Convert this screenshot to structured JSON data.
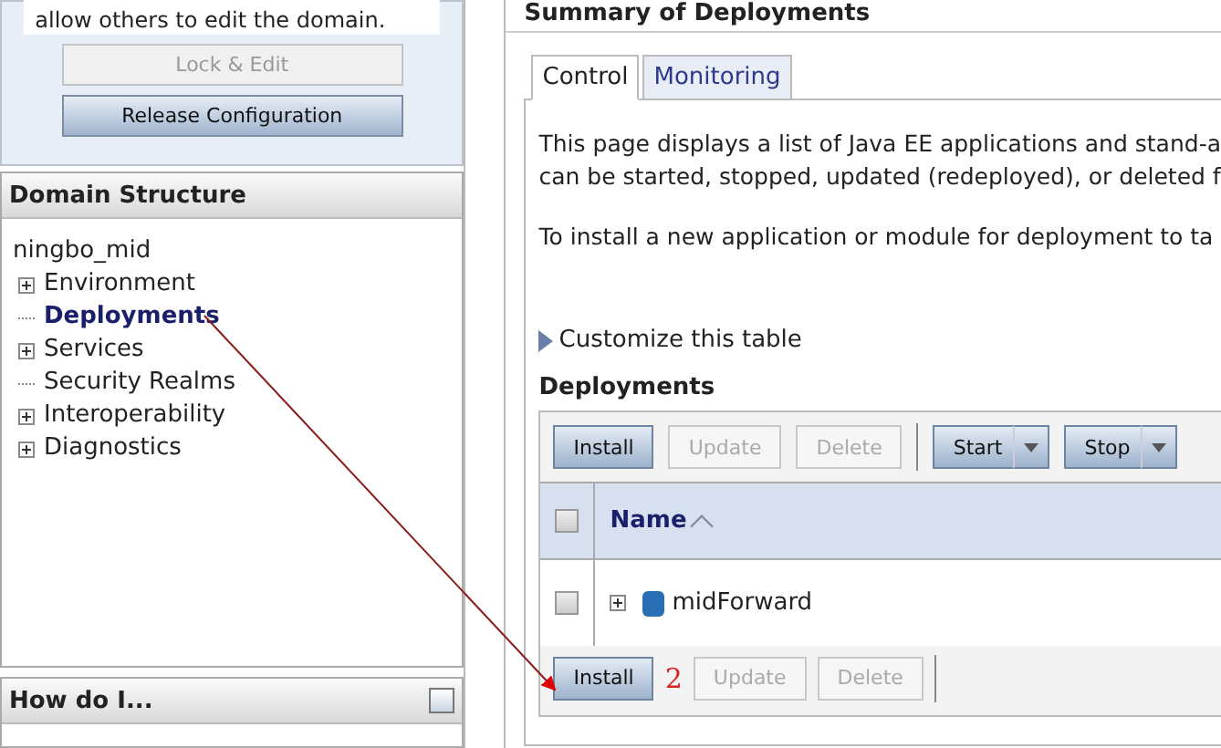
{
  "change_center": {
    "message": "allow others to edit the domain.",
    "buttons": [
      {
        "label": "Lock & Edit",
        "disabled": true
      },
      {
        "label": "Release Configuration",
        "disabled": false
      }
    ]
  },
  "domain_structure": {
    "title": "Domain Structure",
    "root": "ningbo_mid",
    "items": [
      {
        "label": "Environment",
        "expandable": true,
        "selected": false
      },
      {
        "label": "Deployments",
        "expandable": false,
        "selected": true
      },
      {
        "label": "Services",
        "expandable": true,
        "selected": false
      },
      {
        "label": "Security Realms",
        "expandable": false,
        "selected": false
      },
      {
        "label": "Interoperability",
        "expandable": true,
        "selected": false
      },
      {
        "label": "Diagnostics",
        "expandable": true,
        "selected": false
      }
    ]
  },
  "how_do_i": {
    "title": "How do I..."
  },
  "page_title": "Summary of Deployments",
  "tabs": [
    {
      "label": "Control",
      "selected": true
    },
    {
      "label": "Monitoring",
      "selected": false
    }
  ],
  "paragraphs": [
    [
      "This page displays a list of Java EE applications and stand-a",
      "can be started, stopped, updated (redeployed), or deleted f"
    ],
    [
      "To install a new application or module for deployment to ta"
    ]
  ],
  "customize_link": "Customize this table",
  "table": {
    "title": "Deployments",
    "toolbar": [
      {
        "kind": "button",
        "label": "Install",
        "disabled": false
      },
      {
        "kind": "button",
        "label": "Update",
        "disabled": true
      },
      {
        "kind": "button",
        "label": "Delete",
        "disabled": true
      },
      {
        "kind": "separator"
      },
      {
        "kind": "split",
        "label": "Start",
        "disabled": false
      },
      {
        "kind": "split",
        "label": "Stop",
        "disabled": false
      }
    ],
    "select_all_checked": false,
    "columns": [
      {
        "label": "Name",
        "sorted": true
      }
    ],
    "rows": [
      {
        "name": "midForward",
        "checked": false
      }
    ],
    "bottom_toolbar": [
      {
        "kind": "button",
        "label": "Install",
        "disabled": false
      },
      {
        "kind": "button",
        "label": "Update",
        "disabled": true
      },
      {
        "kind": "button",
        "label": "Delete",
        "disabled": true
      },
      {
        "kind": "separator"
      }
    ]
  },
  "annotation": {
    "step": "2"
  }
}
